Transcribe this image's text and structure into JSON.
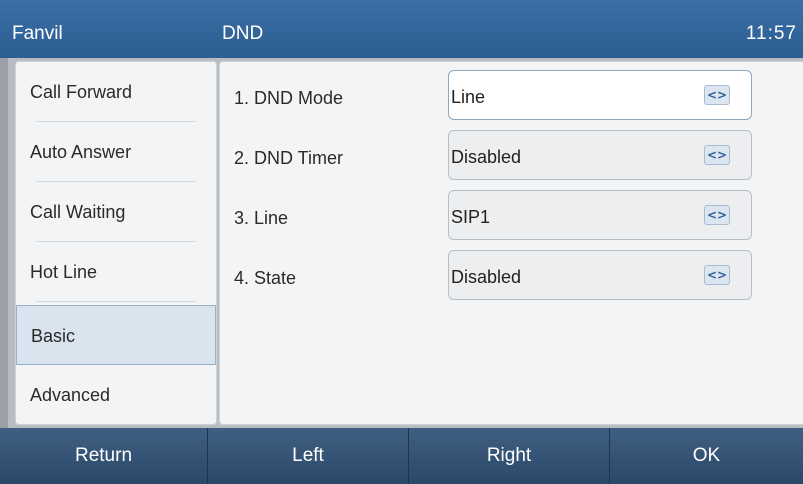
{
  "titlebar": {
    "brand": "Fanvil",
    "page_title": "DND",
    "clock": "11:57"
  },
  "sidebar": {
    "items": [
      {
        "label": "Call Forward",
        "active": false
      },
      {
        "label": "Auto Answer",
        "active": false
      },
      {
        "label": "Call Waiting",
        "active": false
      },
      {
        "label": "Hot Line",
        "active": false
      },
      {
        "label": "Basic",
        "active": true
      },
      {
        "label": "Advanced",
        "active": false
      }
    ]
  },
  "settings": {
    "rows": [
      {
        "label": "1. DND Mode",
        "value": "Line",
        "focused": true,
        "icon": "left-right-arrows-icon",
        "icon_glyph": "<>"
      },
      {
        "label": "2. DND Timer",
        "value": "Disabled",
        "focused": false,
        "icon": "left-right-arrows-icon",
        "icon_glyph": "<>"
      },
      {
        "label": "3. Line",
        "value": "SIP1",
        "focused": false,
        "icon": "left-right-arrows-icon",
        "icon_glyph": "<>"
      },
      {
        "label": "4. State",
        "value": "Disabled",
        "focused": false,
        "icon": "left-right-arrows-icon",
        "icon_glyph": "<>"
      }
    ]
  },
  "softkeys": {
    "return_label": "Return",
    "left_label": "Left",
    "right_label": "Right",
    "ok_label": "OK"
  },
  "colors": {
    "titlebar": "#2c5d92",
    "softkey": "#2b4868",
    "selected_item": "#d9e4ee"
  }
}
